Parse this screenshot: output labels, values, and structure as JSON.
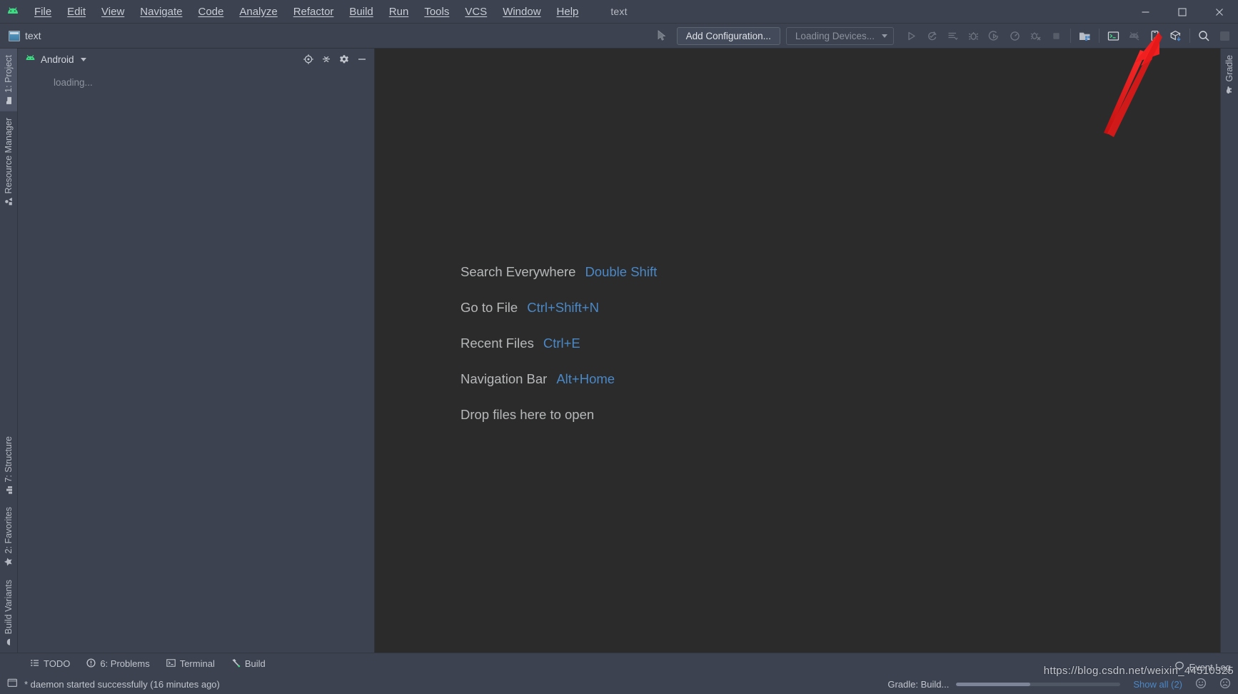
{
  "window": {
    "title": "text",
    "app_icon": "android-studio-logo-icon",
    "controls": [
      {
        "name": "minimize-button",
        "glyph": "minimize-icon"
      },
      {
        "name": "maximize-button",
        "glyph": "maximize-icon"
      },
      {
        "name": "close-button",
        "glyph": "close-icon"
      }
    ]
  },
  "menubar": {
    "items": [
      {
        "label": "File",
        "mnemonic": "F"
      },
      {
        "label": "Edit",
        "mnemonic": "E"
      },
      {
        "label": "View",
        "mnemonic": "V"
      },
      {
        "label": "Navigate",
        "mnemonic": "N"
      },
      {
        "label": "Code",
        "mnemonic": "C"
      },
      {
        "label": "Analyze",
        "mnemonic": "z"
      },
      {
        "label": "Refactor",
        "mnemonic": "R"
      },
      {
        "label": "Build",
        "mnemonic": "B"
      },
      {
        "label": "Run",
        "mnemonic": "u"
      },
      {
        "label": "Tools",
        "mnemonic": "T"
      },
      {
        "label": "VCS",
        "mnemonic": "S"
      },
      {
        "label": "Window",
        "mnemonic": "W"
      },
      {
        "label": "Help",
        "mnemonic": "H"
      }
    ]
  },
  "toolbar": {
    "breadcrumb": "text",
    "breadcrumb_icon": "module-icon",
    "add_configuration_label": "Add Configuration...",
    "device_selector_label": "Loading Devices...",
    "run_icon": "run-play-icon",
    "icons": [
      {
        "name": "run-button",
        "glyph": "play",
        "enabled": false
      },
      {
        "name": "apply-changes-button",
        "glyph": "apply-changes",
        "enabled": false
      },
      {
        "name": "apply-code-changes-button",
        "glyph": "code-changes",
        "enabled": false
      },
      {
        "name": "debug-button",
        "glyph": "bug",
        "enabled": false
      },
      {
        "name": "run-with-coverage-button",
        "glyph": "coverage",
        "enabled": false
      },
      {
        "name": "profile-button",
        "glyph": "profiler",
        "enabled": false
      },
      {
        "name": "attach-debugger-button",
        "glyph": "attach-debugger",
        "enabled": false
      },
      {
        "name": "stop-button",
        "glyph": "stop",
        "enabled": false
      },
      {
        "name": "sync-gradle-button",
        "glyph": "gradle-sync",
        "enabled": true
      },
      {
        "name": "avd-manager-button",
        "glyph": "avd-manager",
        "enabled": true
      },
      {
        "name": "sdk-manager-button",
        "glyph": "sdk-manager",
        "enabled": false
      },
      {
        "name": "device-file-explorer-button",
        "glyph": "device-manager",
        "enabled": true
      },
      {
        "name": "profiler-window-button",
        "glyph": "layout-inspector",
        "enabled": true
      },
      {
        "name": "search-button",
        "glyph": "magnifier",
        "enabled": true
      },
      {
        "name": "settings-overflow-button",
        "glyph": "overflow",
        "enabled": false
      }
    ]
  },
  "left_stripe": {
    "top_tabs": [
      {
        "label": "1: Project",
        "icon": "project-folder-icon",
        "active": true
      },
      {
        "label": "Resource Manager",
        "icon": "resource-manager-icon",
        "active": false
      }
    ],
    "bottom_tabs": [
      {
        "label": "7: Structure",
        "icon": "structure-icon",
        "active": false
      },
      {
        "label": "2: Favorites",
        "icon": "star-icon",
        "active": false
      },
      {
        "label": "Build Variants",
        "icon": "android-variant-icon",
        "active": false
      }
    ]
  },
  "right_stripe": {
    "tabs": [
      {
        "label": "Gradle",
        "icon": "gradle-elephant-icon",
        "active": false
      }
    ]
  },
  "project_panel": {
    "title": "Android",
    "title_icon": "android-head-icon",
    "dropdown_icon": "chevron-down-icon",
    "tools": [
      {
        "name": "select-opened-file-button",
        "icon": "target-icon"
      },
      {
        "name": "collapse-all-button",
        "icon": "collapse-all-icon"
      },
      {
        "name": "panel-settings-button",
        "icon": "gear-icon"
      },
      {
        "name": "hide-panel-button",
        "icon": "minimize-panel-icon"
      }
    ],
    "body_text": "loading..."
  },
  "editor": {
    "hints": [
      {
        "action": "Search Everywhere",
        "shortcut": "Double Shift"
      },
      {
        "action": "Go to File",
        "shortcut": "Ctrl+Shift+N"
      },
      {
        "action": "Recent Files",
        "shortcut": "Ctrl+E"
      },
      {
        "action": "Navigation Bar",
        "shortcut": "Alt+Home"
      },
      {
        "action": "Drop files here to open",
        "shortcut": ""
      }
    ]
  },
  "tool_window_bar": {
    "items": [
      {
        "label": "TODO",
        "icon": "todo-icon",
        "mnemonic": ""
      },
      {
        "label": "6: Problems",
        "icon": "problems-icon",
        "mnemonic": "6"
      },
      {
        "label": "Terminal",
        "icon": "terminal-icon",
        "mnemonic": ""
      },
      {
        "label": "Build",
        "icon": "build-hammer-icon",
        "mnemonic": ""
      }
    ]
  },
  "statusbar": {
    "message": "* daemon started successfully (16 minutes ago)",
    "message_icon": "console-icon",
    "gradle_task": "Gradle: Build...",
    "progress_percent": 45,
    "event_log_label": "Event Log",
    "event_log_icon": "balloon-icon",
    "show_all_label": "Show all (2)",
    "watermark": "https://blog.csdn.net/weixin_44510325"
  },
  "annotation": {
    "type": "red-arrow",
    "color": "#f02020",
    "points_to": "avd-manager-button"
  },
  "colors": {
    "chrome": "#3c4250",
    "editor_bg": "#2b2b2b",
    "accent_blue": "#4a88c7",
    "text_primary": "#c8ccd4",
    "text_dim": "#8e949e",
    "annotation_red": "#f02020"
  }
}
